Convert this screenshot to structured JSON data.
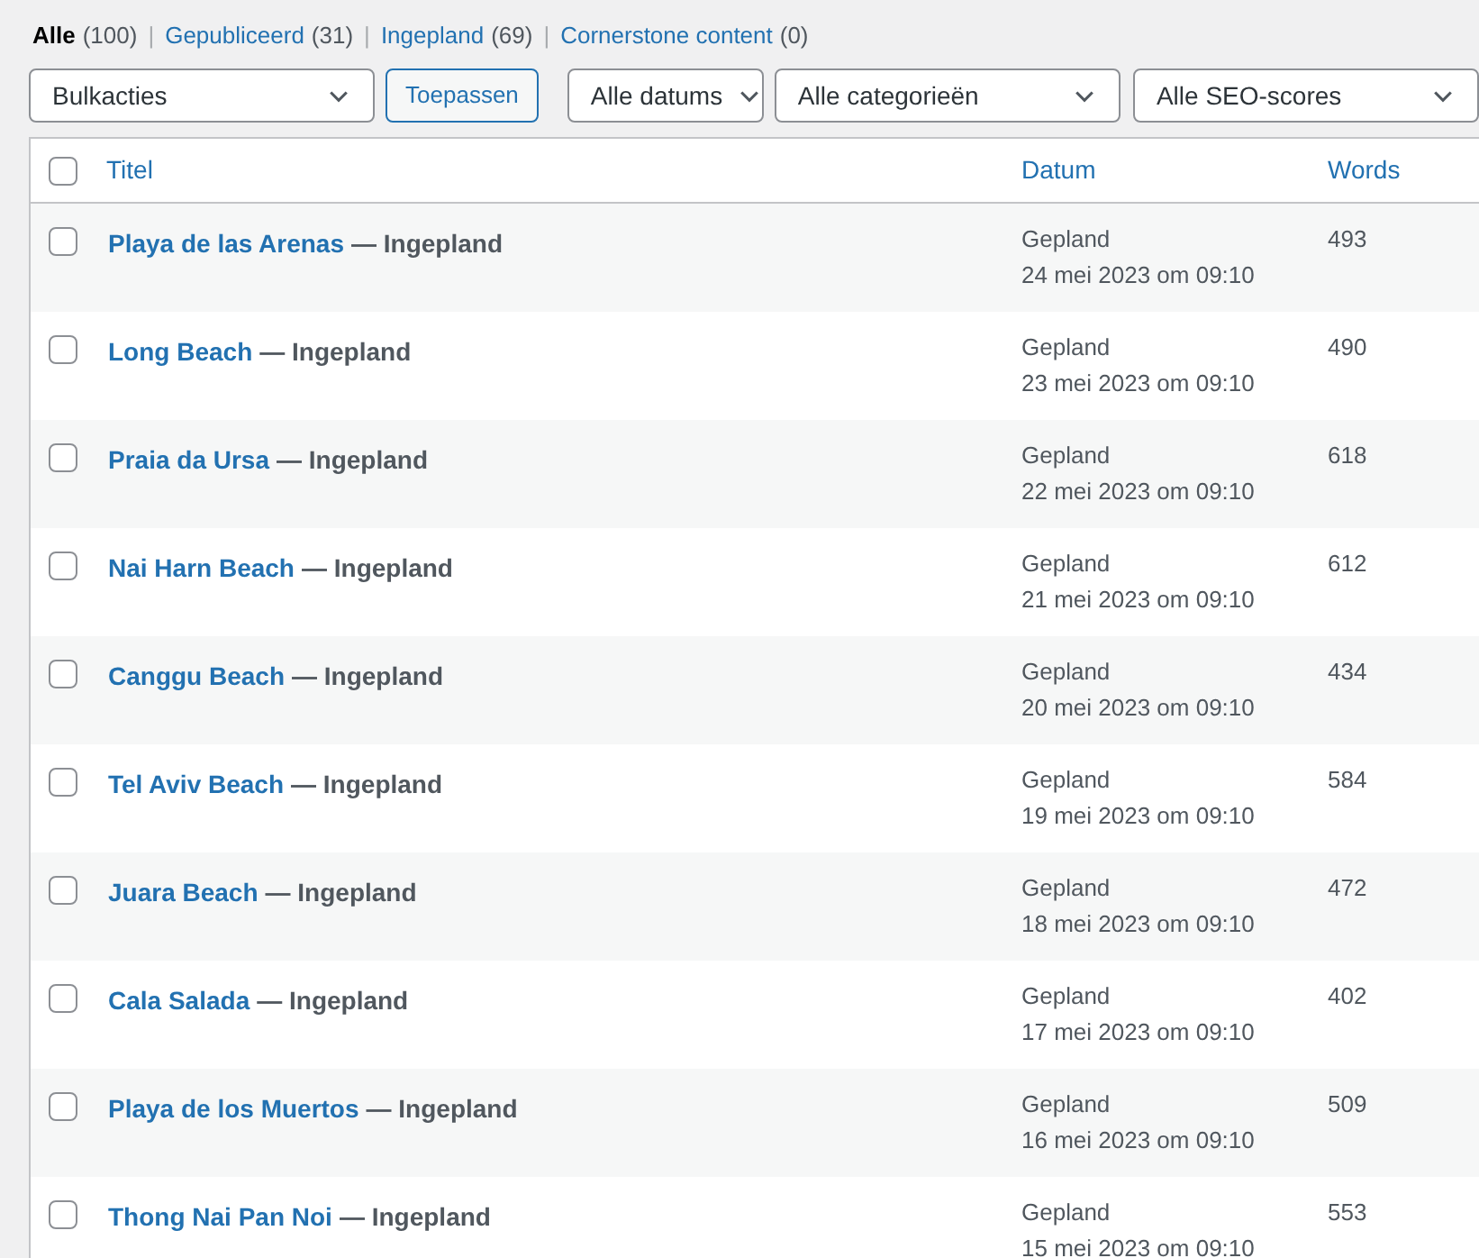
{
  "status_filters": [
    {
      "label": "Alle",
      "count": "(100)",
      "selected": true
    },
    {
      "label": "Gepubliceerd",
      "count": "(31)",
      "selected": false
    },
    {
      "label": "Ingepland",
      "count": "(69)",
      "selected": false
    },
    {
      "label": "Cornerstone content",
      "count": "(0)",
      "selected": false
    }
  ],
  "separator": "|",
  "bulk_actions": {
    "value": "Bulkacties"
  },
  "apply_button": "Toepassen",
  "filters": [
    {
      "value": "Alle datums"
    },
    {
      "value": "Alle categorieën"
    },
    {
      "value": "Alle SEO-scores"
    }
  ],
  "table": {
    "columns": [
      "Titel",
      "Datum",
      "Words"
    ],
    "select_all_checked": false,
    "rows": [
      {
        "title": "Playa de las Arenas",
        "state": "— Ingepland",
        "status": "Gepland",
        "date": "24 mei 2023 om 09:10",
        "words": "493",
        "checked": false
      },
      {
        "title": "Long Beach",
        "state": "— Ingepland",
        "status": "Gepland",
        "date": "23 mei 2023 om 09:10",
        "words": "490",
        "checked": false
      },
      {
        "title": "Praia da Ursa",
        "state": "— Ingepland",
        "status": "Gepland",
        "date": "22 mei 2023 om 09:10",
        "words": "618",
        "checked": false
      },
      {
        "title": "Nai Harn Beach",
        "state": "— Ingepland",
        "status": "Gepland",
        "date": "21 mei 2023 om 09:10",
        "words": "612",
        "checked": false
      },
      {
        "title": "Canggu Beach",
        "state": "— Ingepland",
        "status": "Gepland",
        "date": "20 mei 2023 om 09:10",
        "words": "434",
        "checked": false
      },
      {
        "title": "Tel Aviv Beach",
        "state": "— Ingepland",
        "status": "Gepland",
        "date": "19 mei 2023 om 09:10",
        "words": "584",
        "checked": false
      },
      {
        "title": "Juara Beach",
        "state": "— Ingepland",
        "status": "Gepland",
        "date": "18 mei 2023 om 09:10",
        "words": "472",
        "checked": false
      },
      {
        "title": "Cala Salada",
        "state": "— Ingepland",
        "status": "Gepland",
        "date": "17 mei 2023 om 09:10",
        "words": "402",
        "checked": false
      },
      {
        "title": "Playa de los Muertos",
        "state": "— Ingepland",
        "status": "Gepland",
        "date": "16 mei 2023 om 09:10",
        "words": "509",
        "checked": false
      },
      {
        "title": "Thong Nai Pan Noi",
        "state": "— Ingepland",
        "status": "Gepland",
        "date": "15 mei 2023 om 09:10",
        "words": "553",
        "checked": false
      }
    ]
  }
}
